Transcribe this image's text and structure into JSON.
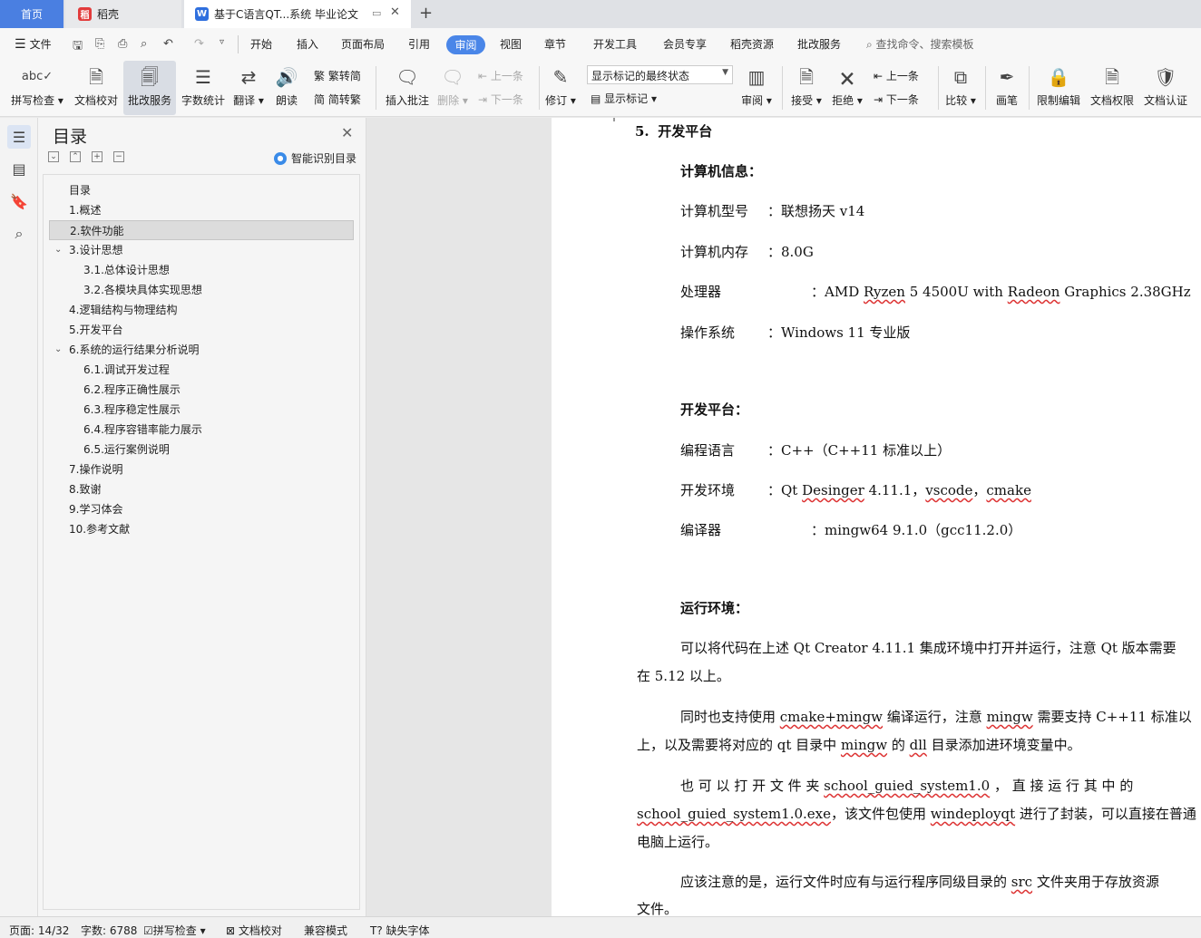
{
  "tabs": {
    "home": "首页",
    "daoke": "稻壳",
    "doc": "基于C语言QT...系统 毕业论文"
  },
  "menu": {
    "file": "文件",
    "items": [
      "开始",
      "插入",
      "页面布局",
      "引用",
      "审阅",
      "视图",
      "章节",
      "开发工具",
      "会员专享",
      "稻壳资源",
      "批改服务"
    ],
    "search_placeholder": "查找命令、搜索模板"
  },
  "ribbon": {
    "spell_check": "拼写检查",
    "doc_proof": "文档校对",
    "review_service": "批改服务",
    "word_count": "字数统计",
    "translate": "翻译",
    "read_aloud": "朗读",
    "to_traditional": "繁转简",
    "to_simplified": "简转繁",
    "insert_comment": "插入批注",
    "delete": "删除",
    "prev_item": "上一条",
    "next_item": "下一条",
    "track_changes": "修订",
    "markup_state": "显示标记的最终状态",
    "show_markup": "显示标记",
    "review_pane": "审阅",
    "accept": "接受",
    "reject": "拒绝",
    "prev_change": "上一条",
    "next_change": "下一条",
    "compare": "比较",
    "pen": "画笔",
    "restrict_edit": "限制编辑",
    "doc_permission": "文档权限",
    "doc_certify": "文档认证"
  },
  "toc": {
    "title": "目录",
    "smart_label": "智能识别目录",
    "items": [
      {
        "label": "目录",
        "level": 1,
        "selected": false,
        "caret": false
      },
      {
        "label": "1.概述",
        "level": 1,
        "selected": false,
        "caret": false
      },
      {
        "label": "2.软件功能",
        "level": 1,
        "selected": true,
        "caret": false
      },
      {
        "label": "3.设计思想",
        "level": 1,
        "selected": false,
        "caret": true
      },
      {
        "label": "3.1.总体设计思想",
        "level": 2,
        "selected": false,
        "caret": false
      },
      {
        "label": "3.2.各模块具体实现思想",
        "level": 2,
        "selected": false,
        "caret": false
      },
      {
        "label": "4.逻辑结构与物理结构",
        "level": 1,
        "selected": false,
        "caret": false
      },
      {
        "label": "5.开发平台",
        "level": 1,
        "selected": false,
        "caret": false
      },
      {
        "label": "6.系统的运行结果分析说明",
        "level": 1,
        "selected": false,
        "caret": true
      },
      {
        "label": "6.1.调试开发过程",
        "level": 2,
        "selected": false,
        "caret": false
      },
      {
        "label": "6.2.程序正确性展示",
        "level": 2,
        "selected": false,
        "caret": false
      },
      {
        "label": "6.3.程序稳定性展示",
        "level": 2,
        "selected": false,
        "caret": false
      },
      {
        "label": "6.4.程序容错率能力展示",
        "level": 2,
        "selected": false,
        "caret": false
      },
      {
        "label": "6.5.运行案例说明",
        "level": 2,
        "selected": false,
        "caret": false
      },
      {
        "label": "7.操作说明",
        "level": 1,
        "selected": false,
        "caret": false
      },
      {
        "label": "8.致谢",
        "level": 1,
        "selected": false,
        "caret": false
      },
      {
        "label": "9.学习体会",
        "level": 1,
        "selected": false,
        "caret": false
      },
      {
        "label": "10.参考文献",
        "level": 1,
        "selected": false,
        "caret": false
      }
    ]
  },
  "doc": {
    "heading_num": "5.",
    "heading": "开发平台",
    "computer_info": "计算机信息：",
    "model_label": "计算机型号",
    "model_value": "：联想扬天 v14",
    "memory_label": "计算机内存",
    "memory_value": "：8.0G",
    "cpu_label": "处理器",
    "cpu_value_pre": "：AMD ",
    "cpu_value_w1": "Ryzen",
    "cpu_value_mid": " 5 4500U with ",
    "cpu_value_w2": "Radeon",
    "cpu_value_post": " Graphics 2.38GHz",
    "os_label": "操作系统",
    "os_value": "：Windows 11 专业版",
    "dev_platform": "开发平台：",
    "lang_label": "编程语言",
    "lang_value": "：C++（C++11 标准以上）",
    "env_label": "开发环境",
    "env_pre": "：Qt ",
    "env_w1": "Desinger",
    "env_mid": " 4.11.1，",
    "env_w2": "vscode",
    "env_sep": "，",
    "env_w3": "cmake",
    "compiler_label": "编译器",
    "compiler_value": "：mingw64 9.1.0（gcc11.2.0）",
    "runtime_env": "运行环境：",
    "p1_l1": "可以将代码在上述 Qt Creator 4.11.1 集成环境中打开并运行，注意 Qt 版本需要",
    "p1_l2": "在 5.12 以上。",
    "p2_l1_a": "同时也支持使用 ",
    "p2_l1_w": "cmake+mingw",
    "p2_l1_b": " 编译运行，注意 ",
    "p2_l1_w2": "mingw",
    "p2_l1_c": " 需要支持 C++11 标准以",
    "p2_l2_a": "上，以及需要将对应的 qt 目录中 ",
    "p2_l2_w": "mingw",
    "p2_l2_b": " 的 ",
    "p2_l2_w2": "dll",
    "p2_l2_c": " 目录添加进环境变量中。",
    "p3_l1_a": "也 可 以 打 开 文 件 夹   ",
    "p3_l1_w": "school_guied_system1.0",
    "p3_l1_b": " ，  直  接  运  行  其  中  的",
    "p3_l2_w": "school_guied_system1.0.exe",
    "p3_l2_a": "，该文件包使用 ",
    "p3_l2_w2": "windeployqt",
    "p3_l2_b": " 进行了封装，可以直接在普通",
    "p3_l3": "电脑上运行。",
    "p4_l1_a": "应该注意的是，运行文件时应有与运行程序同级目录的 ",
    "p4_l1_w": "src",
    "p4_l1_b": " 文件夹用于存放资源",
    "p4_l2": "文件。"
  },
  "status": {
    "page": "页面: 14/32",
    "words": "字数: 6788",
    "spell": "拼写检查",
    "proof": "文档校对",
    "compat": "兼容模式",
    "missing_font": "缺失字体"
  }
}
